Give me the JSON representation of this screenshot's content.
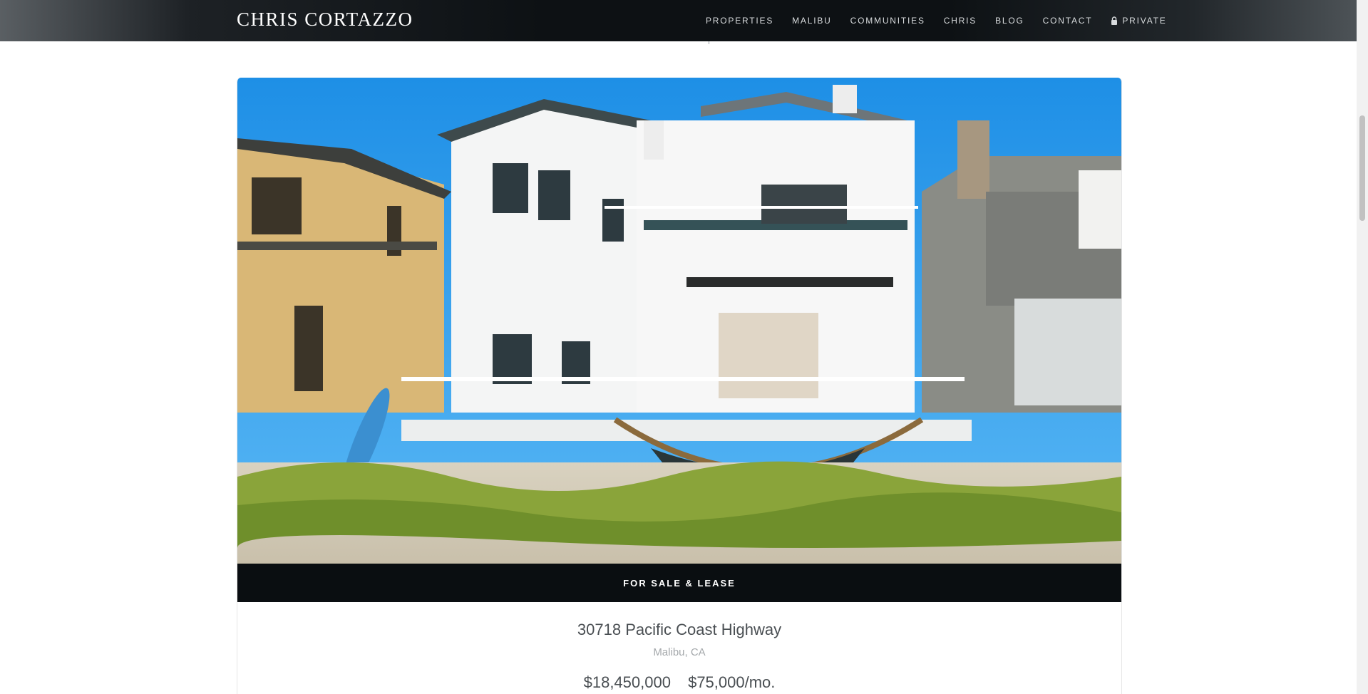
{
  "header": {
    "brand": "CHRIS CORTAZZO",
    "nav": [
      {
        "label": "PROPERTIES"
      },
      {
        "label": "MALIBU"
      },
      {
        "label": "COMMUNITIES"
      },
      {
        "label": "CHRIS"
      },
      {
        "label": "BLOG"
      },
      {
        "label": "CONTACT"
      },
      {
        "label": "PRIVATE",
        "icon": "lock-icon"
      }
    ]
  },
  "listing": {
    "status": "FOR SALE & LEASE",
    "address": "30718 Pacific Coast Highway",
    "city": "Malibu, CA",
    "sale_price": "$18,450,000",
    "lease_price": "$75,000/mo."
  },
  "colors": {
    "header_bg": "#0d1114",
    "status_bar_bg": "#0a0e11",
    "sky": "#2f9be9"
  }
}
